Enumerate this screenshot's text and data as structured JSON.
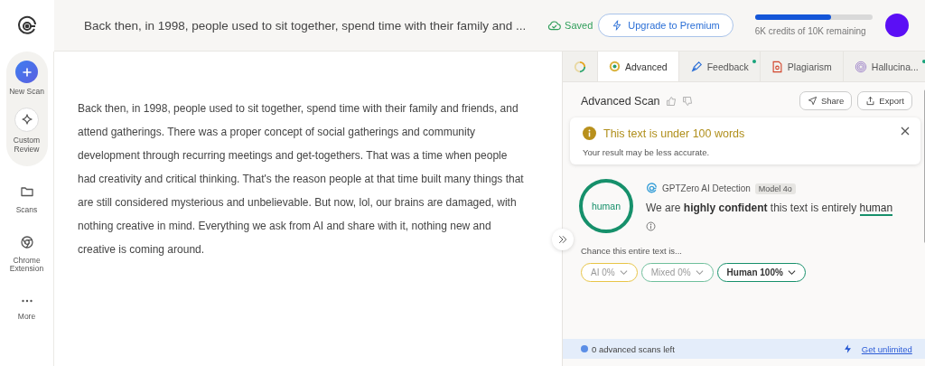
{
  "header": {
    "document_title": "Back then, in 1998, people used to sit together, spend time with their family and ...",
    "save_status": "Saved",
    "upgrade_button": "Upgrade to Premium",
    "credits": {
      "level": 0.65,
      "label": "6K credits of 10K remaining"
    }
  },
  "sidebar": {
    "items": [
      {
        "kind": "new",
        "label": "New Scan"
      },
      {
        "kind": "custom",
        "label": "Custom Review"
      },
      {
        "kind": "folder",
        "label": "Scans"
      },
      {
        "kind": "chrome",
        "label": "Chrome Extension"
      },
      {
        "kind": "more",
        "label": "More"
      }
    ]
  },
  "editor": {
    "text": "Back then, in 1998, people used to sit together, spend time with their family and friends, and attend gatherings. There was a proper concept of social gatherings and community development through recurring meetings and get-togethers. That was a time when people had creativity and critical thinking. That's the reason people at that time built many things that are still considered mysterious and unbelievable. But now, lol, our brains are damaged, with nothing creative in mind. Everything we ask from AI and share with it, nothing new and creative is coming around."
  },
  "panel": {
    "tabs": [
      {
        "kind": "loader",
        "selected": false
      },
      {
        "kind": "advanced",
        "label": "Advanced",
        "selected": true,
        "new": false
      },
      {
        "kind": "feedback",
        "label": "Feedback",
        "selected": false,
        "new": true
      },
      {
        "kind": "plagiarism",
        "label": "Plagiarism",
        "selected": false,
        "new": false
      },
      {
        "kind": "hallucination",
        "label": "Hallucina...",
        "selected": false,
        "new": true
      }
    ],
    "title": "Advanced Scan",
    "actions": [
      "Share",
      "Export"
    ],
    "notice": {
      "title": "This text is under 100 words",
      "message": "Your result may be less accurate."
    },
    "result": {
      "verdict": "human",
      "source": "GPTZero AI Detection",
      "model": "Model 4o",
      "sentence": "We are **highly confident** this text is entirely",
      "verdict_link": "human"
    },
    "chance_label": "Chance this entire text is...",
    "chances": [
      {
        "label": "AI 0%",
        "color": "#e8c547",
        "selected": false
      },
      {
        "label": "Mixed 0%",
        "color": "#6fbf9c",
        "selected": false
      },
      {
        "label": "Human 100%",
        "color": "#16906b",
        "selected": true
      }
    ],
    "footer": {
      "scans_left": "0 advanced scans left",
      "link": "Get unlimited"
    }
  }
}
